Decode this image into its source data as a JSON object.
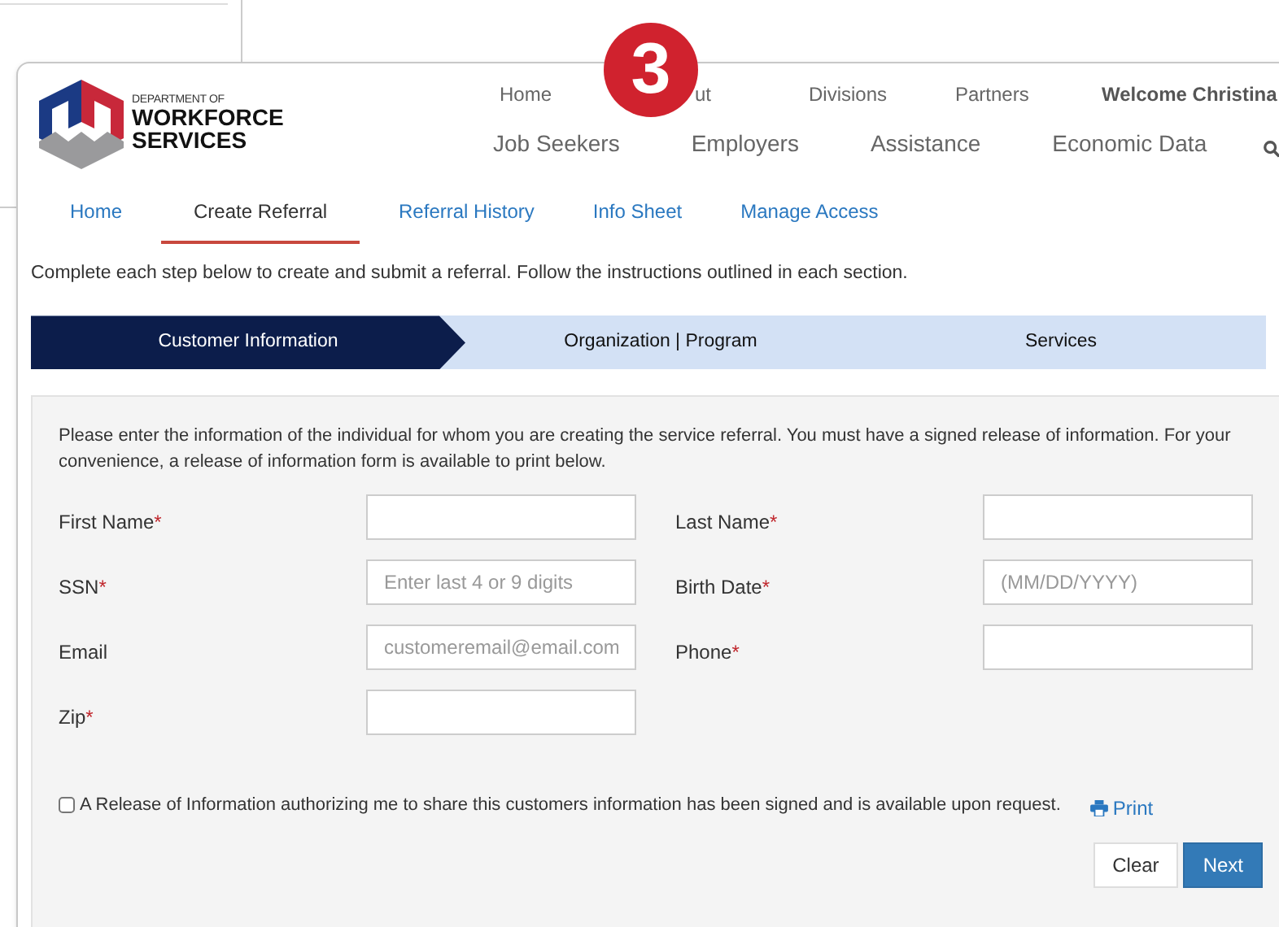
{
  "logo": {
    "line_1": "DEPARTMENT OF",
    "line_2": "WORKFORCE",
    "line_3": "SERVICES"
  },
  "badge": "3",
  "top_links": [
    {
      "label": "Home"
    },
    {
      "label": "ut"
    },
    {
      "label": "Divisions"
    },
    {
      "label": "Partners"
    }
  ],
  "welcome": "Welcome Christina",
  "main_nav": [
    {
      "label": "Job Seekers"
    },
    {
      "label": "Employers"
    },
    {
      "label": "Assistance"
    },
    {
      "label": "Economic Data"
    }
  ],
  "tabs": [
    {
      "label": "Home",
      "selected": false
    },
    {
      "label": "Create Referral",
      "selected": true
    },
    {
      "label": "Referral History",
      "selected": false
    },
    {
      "label": "Info Sheet",
      "selected": false
    },
    {
      "label": "Manage Access",
      "selected": false
    }
  ],
  "intro": "Complete each step below to create and submit a referral. Follow the instructions outlined in each section.",
  "steps": [
    {
      "label": "Customer Information",
      "selected": true
    },
    {
      "label": "Organization | Program",
      "selected": false
    },
    {
      "label": "Services",
      "selected": false
    }
  ],
  "form_intro": "Please enter the information of the individual for whom you are creating the service referral. You must have a signed release of information. For your convenience, a release of information form is available to print below.",
  "required_mark": "*",
  "fields": [
    {
      "label": "First Name",
      "required": true
    },
    {
      "label": "Last Name",
      "required": true
    },
    {
      "label": "SSN",
      "required": true,
      "placeholder": "Enter last 4 or 9 digits"
    },
    {
      "label": "Birth Date",
      "required": true,
      "placeholder": "(MM/DD/YYYY)"
    },
    {
      "label": "Email",
      "required": false,
      "placeholder": "customeremail@email.com"
    },
    {
      "label": "Phone",
      "required": true
    },
    {
      "label": "Zip",
      "required": true
    }
  ],
  "release": {
    "label": "A Release of Information authorizing me to share this customers information has been signed and is available upon request.",
    "checked": false
  },
  "print": "Print",
  "buttons": [
    {
      "label": "Clear",
      "kind": "secondary"
    },
    {
      "label": "Next",
      "kind": "primary"
    }
  ]
}
